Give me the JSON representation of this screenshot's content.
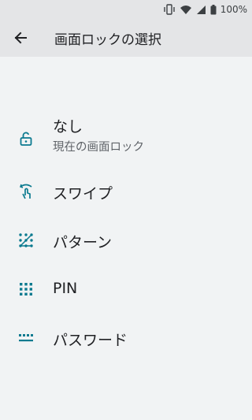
{
  "status": {
    "battery_text": "100%",
    "icons": [
      "vibrate-icon",
      "wifi-icon",
      "signal-icon",
      "battery-icon"
    ]
  },
  "app_bar": {
    "back_icon": "arrow-back-icon",
    "title": "画面ロックの選択"
  },
  "options": [
    {
      "icon": "lock-open-icon",
      "title": "なし",
      "subtitle": "現在の画面ロック"
    },
    {
      "icon": "swipe-icon",
      "title": "スワイプ"
    },
    {
      "icon": "pattern-icon",
      "title": "パターン"
    },
    {
      "icon": "pin-icon",
      "title": "PIN"
    },
    {
      "icon": "password-icon",
      "title": "パスワード"
    }
  ],
  "colors": {
    "accent": "#0b7a8f",
    "background": "#f1f3f4",
    "bar": "#e4e5e7",
    "text_primary": "#202124",
    "text_secondary": "#5f6368"
  }
}
